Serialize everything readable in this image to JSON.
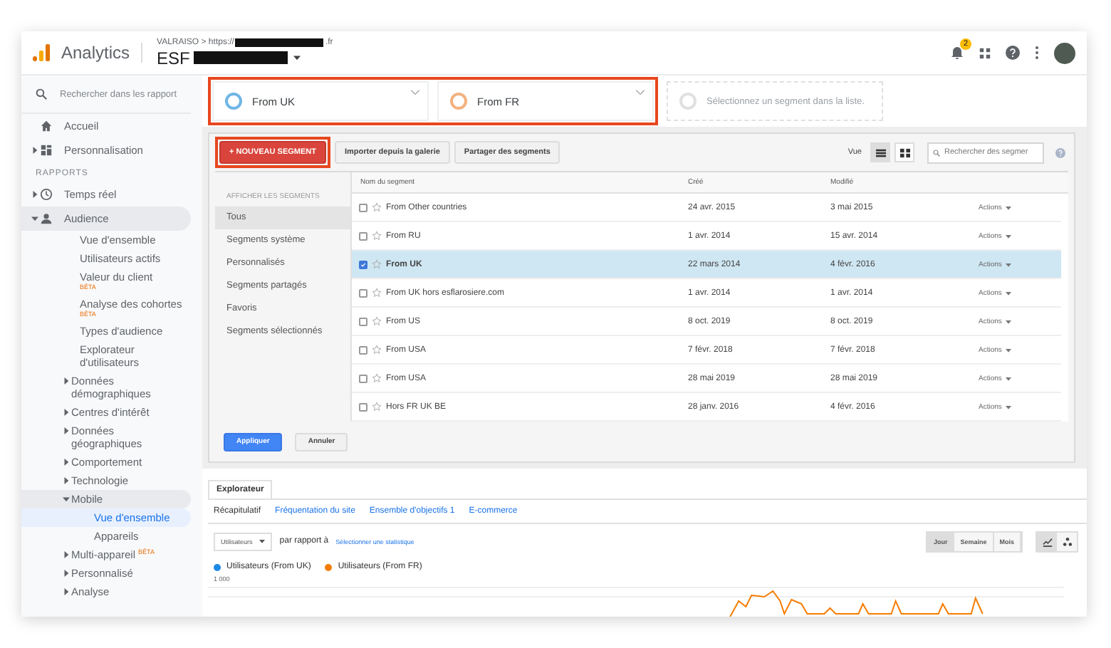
{
  "header": {
    "product": "Analytics",
    "breadcrumb_prefix": "VALRAISO > https://",
    "breadcrumb_suffix": ".fr",
    "property": "ESF",
    "notification_count": "2"
  },
  "sidebar": {
    "search_placeholder": "Rechercher dans les rapport",
    "items": [
      {
        "kind": "item",
        "label": "Accueil",
        "selected": false
      },
      {
        "kind": "folder",
        "label": "Personnalisation",
        "expanded": false,
        "selected": false
      },
      {
        "kind": "heading",
        "label": "RAPPORTS"
      },
      {
        "kind": "folder",
        "label": "Temps réel",
        "expanded": false,
        "selected": false
      },
      {
        "kind": "folder",
        "label": "Audience",
        "expanded": true,
        "selected": true,
        "children": [
          {
            "kind": "item",
            "label": "Vue d'ensemble",
            "selected": false
          },
          {
            "kind": "item",
            "label": "Utilisateurs actifs",
            "selected": false
          },
          {
            "kind": "item",
            "label": "Valeur du client",
            "badge": "BÊTA",
            "selected": false
          },
          {
            "kind": "item",
            "label": "Analyse des cohortes",
            "badge": "BÊTA",
            "selected": false
          },
          {
            "kind": "item",
            "label": "Types d'audience",
            "selected": false
          },
          {
            "kind": "item",
            "label": "Explorateur d'utilisateurs",
            "selected": false
          },
          {
            "kind": "folder",
            "label": "Données démographiques",
            "expanded": false,
            "selected": false
          },
          {
            "kind": "folder",
            "label": "Centres d'intérêt",
            "expanded": false,
            "selected": false
          },
          {
            "kind": "folder",
            "label": "Données géographiques",
            "expanded": false,
            "selected": false
          },
          {
            "kind": "folder",
            "label": "Comportement",
            "expanded": false,
            "selected": false
          },
          {
            "kind": "folder",
            "label": "Technologie",
            "expanded": false,
            "selected": false
          },
          {
            "kind": "folder",
            "label": "Mobile",
            "expanded": true,
            "selected": true,
            "children": [
              {
                "kind": "item",
                "label": "Vue d'ensemble",
                "selected": true
              },
              {
                "kind": "item",
                "label": "Appareils",
                "selected": false
              }
            ]
          },
          {
            "kind": "folder",
            "label": "Multi-appareil",
            "badge": "BÊTA",
            "expanded": false,
            "selected": false
          },
          {
            "kind": "folder",
            "label": "Personnalisé",
            "expanded": false,
            "selected": false
          },
          {
            "kind": "folder",
            "label": "Analyse",
            "expanded": false,
            "selected": false
          }
        ]
      }
    ]
  },
  "segments": [
    {
      "name": "From UK",
      "color": "#6fb6e6"
    },
    {
      "name": "From FR",
      "color": "#f3b27f"
    }
  ],
  "segment_placeholder": "Sélectionnez un segment dans la liste.",
  "toolbar": {
    "buttons": [
      {
        "kind": "primary",
        "label": "+ NOUVEAU SEGMENT"
      },
      {
        "kind": "default",
        "label": "Importer depuis la galerie"
      },
      {
        "kind": "default",
        "label": "Partager des segments"
      }
    ],
    "view_label": "Vue",
    "view_modes": [
      {
        "selected": true
      },
      {
        "selected": false
      }
    ],
    "search_placeholder": "Rechercher des segmer"
  },
  "filters": {
    "heading": "AFFICHER LES SEGMENTS",
    "items": [
      {
        "label": "Tous",
        "selected": true
      },
      {
        "label": "Segments système",
        "selected": false
      },
      {
        "label": "Personnalisés",
        "selected": false
      },
      {
        "label": "Segments partagés",
        "selected": false
      },
      {
        "label": "Favoris",
        "selected": false
      },
      {
        "label": "Segments sélectionnés",
        "selected": false
      }
    ]
  },
  "table": {
    "columns": [
      "Nom du segment",
      "Créé",
      "Modifié"
    ],
    "rows": [
      {
        "name": "From Other countries",
        "created": "24 avr. 2015",
        "modified": "3 mai 2015",
        "actions": "Actions",
        "checked": false
      },
      {
        "name": "From RU",
        "created": "1 avr. 2014",
        "modified": "15 avr. 2014",
        "actions": "Actions",
        "checked": false
      },
      {
        "name": "From UK",
        "created": "22 mars 2014",
        "modified": "4 févr. 2016",
        "actions": "Actions",
        "checked": true
      },
      {
        "name": "From UK hors esflarosiere.com",
        "created": "1 avr. 2014",
        "modified": "1 avr. 2014",
        "actions": "Actions",
        "checked": false
      },
      {
        "name": "From US",
        "created": "8 oct. 2019",
        "modified": "8 oct. 2019",
        "actions": "Actions",
        "checked": false
      },
      {
        "name": "From USA",
        "created": "7 févr. 2018",
        "modified": "7 févr. 2018",
        "actions": "Actions",
        "checked": false
      },
      {
        "name": "From USA",
        "created": "28 mai 2019",
        "modified": "28 mai 2019",
        "actions": "Actions",
        "checked": false
      },
      {
        "name": "Hors FR UK BE",
        "created": "28 janv. 2016",
        "modified": "4 févr. 2016",
        "actions": "Actions",
        "checked": false
      }
    ]
  },
  "footer_buttons": [
    {
      "kind": "primary",
      "label": "Appliquer"
    },
    {
      "kind": "default",
      "label": "Annuler"
    }
  ],
  "explorer": {
    "tabs": [
      {
        "label": "Explorateur",
        "selected": true
      }
    ],
    "subtabs": [
      {
        "label": "Récapitulatif",
        "selected": true
      },
      {
        "label": "Fréquentation du site",
        "selected": false
      },
      {
        "label": "Ensemble d'objectifs 1",
        "selected": false
      },
      {
        "label": "E-commerce",
        "selected": false
      }
    ],
    "metric": "Utilisateurs",
    "compare_label": "par rapport à",
    "compare_link": "Sélectionner une statistique",
    "periods": [
      {
        "label": "Jour",
        "selected": true
      },
      {
        "label": "Semaine",
        "selected": false
      },
      {
        "label": "Mois",
        "selected": false
      }
    ],
    "chart_types": [
      {
        "selected": true
      },
      {
        "selected": false
      }
    ],
    "legend": [
      {
        "label": "Utilisateurs (From UK)",
        "color": "#1e88e5"
      },
      {
        "label": "Utilisateurs (From FR)",
        "color": "#f57c00"
      }
    ],
    "y_tick": "1 000"
  }
}
